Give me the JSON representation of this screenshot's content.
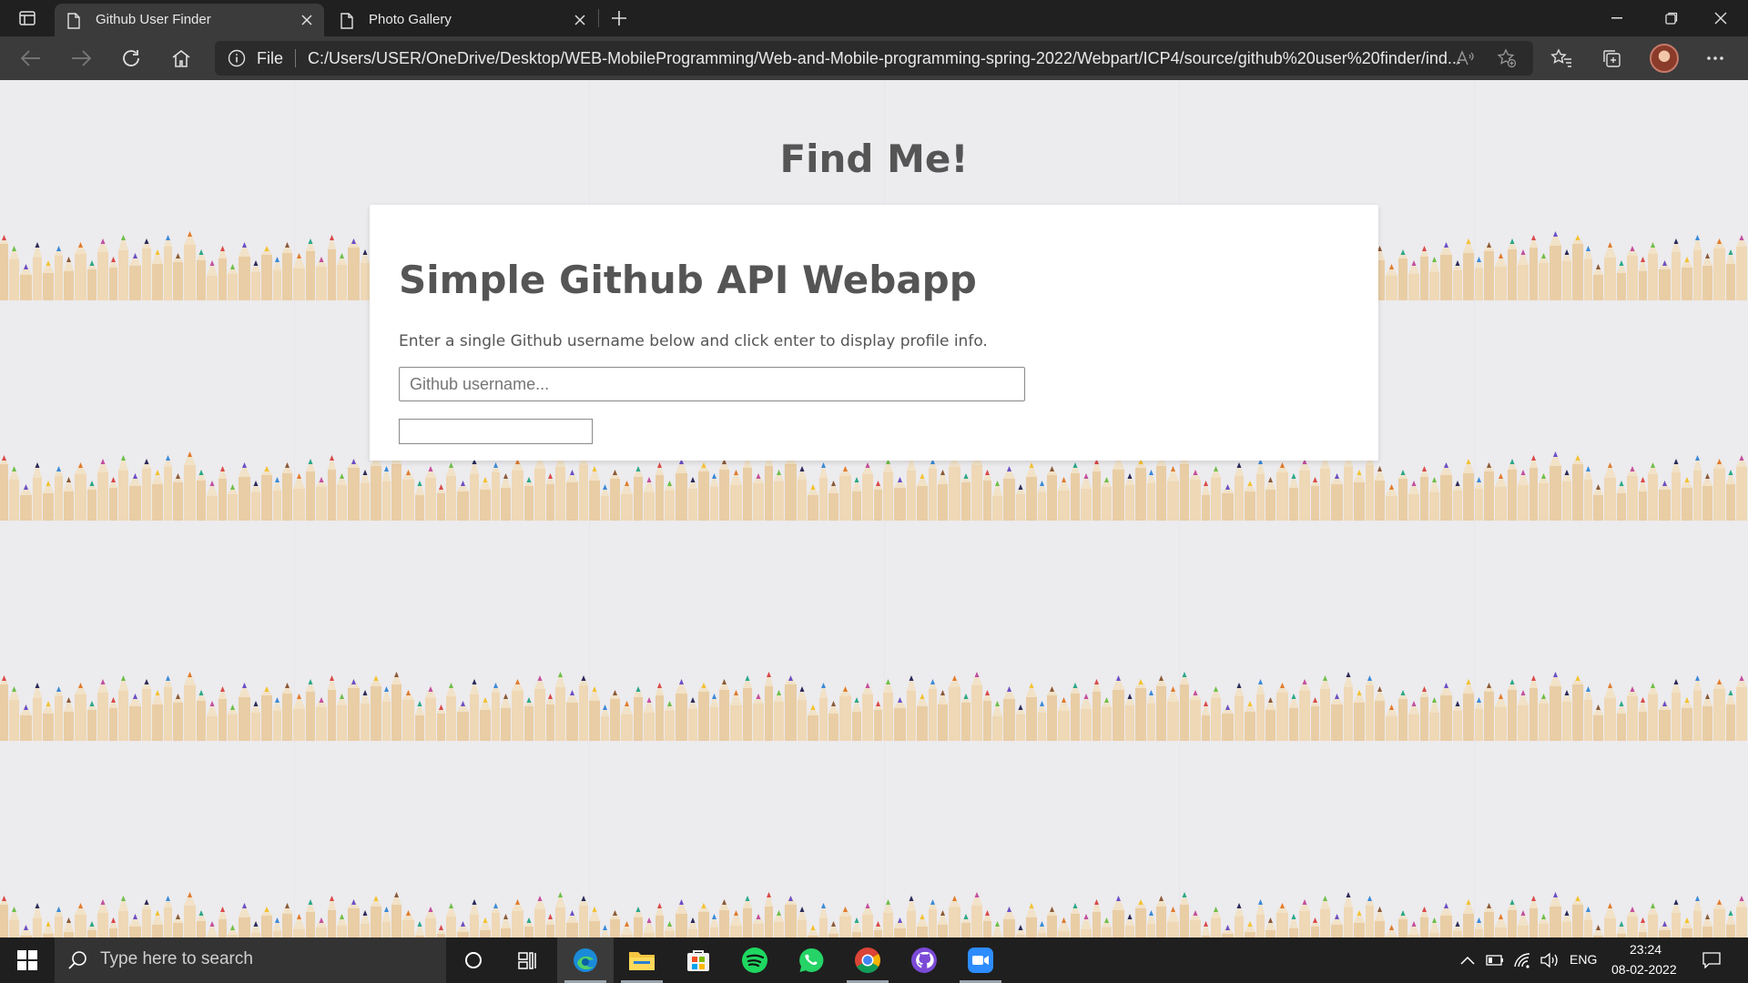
{
  "browser": {
    "tabs": [
      {
        "label": "Github User Finder",
        "active": true
      },
      {
        "label": "Photo Gallery",
        "active": false
      }
    ],
    "address": {
      "scheme_label": "File",
      "url": "C:/Users/USER/OneDrive/Desktop/WEB-MobileProgramming/Web-and-Mobile-programming-spring-2022/Webpart/ICP4/source/github%20user%20finder/ind..."
    }
  },
  "page": {
    "heading": "Find Me!",
    "card": {
      "title": "Simple Github API Webapp",
      "description": "Enter a single Github username below and click enter to display profile info.",
      "input_placeholder": "Github username...",
      "input_value": ""
    }
  },
  "taskbar": {
    "search_placeholder": "Type here to search",
    "apps": [
      "cortana-icon",
      "task-view-icon",
      "edge-icon",
      "file-explorer-icon",
      "store-icon",
      "spotify-icon",
      "whatsapp-icon",
      "chrome-icon",
      "github-desktop-icon",
      "zoom-icon"
    ],
    "tray": {
      "language": "ENG",
      "time": "23:24",
      "date": "08-02-2022"
    }
  },
  "colors": {
    "chrome_dark": "#202020",
    "toolbar": "#3b3b3b",
    "page_bg": "#ecebee",
    "heading_text": "#555555"
  }
}
